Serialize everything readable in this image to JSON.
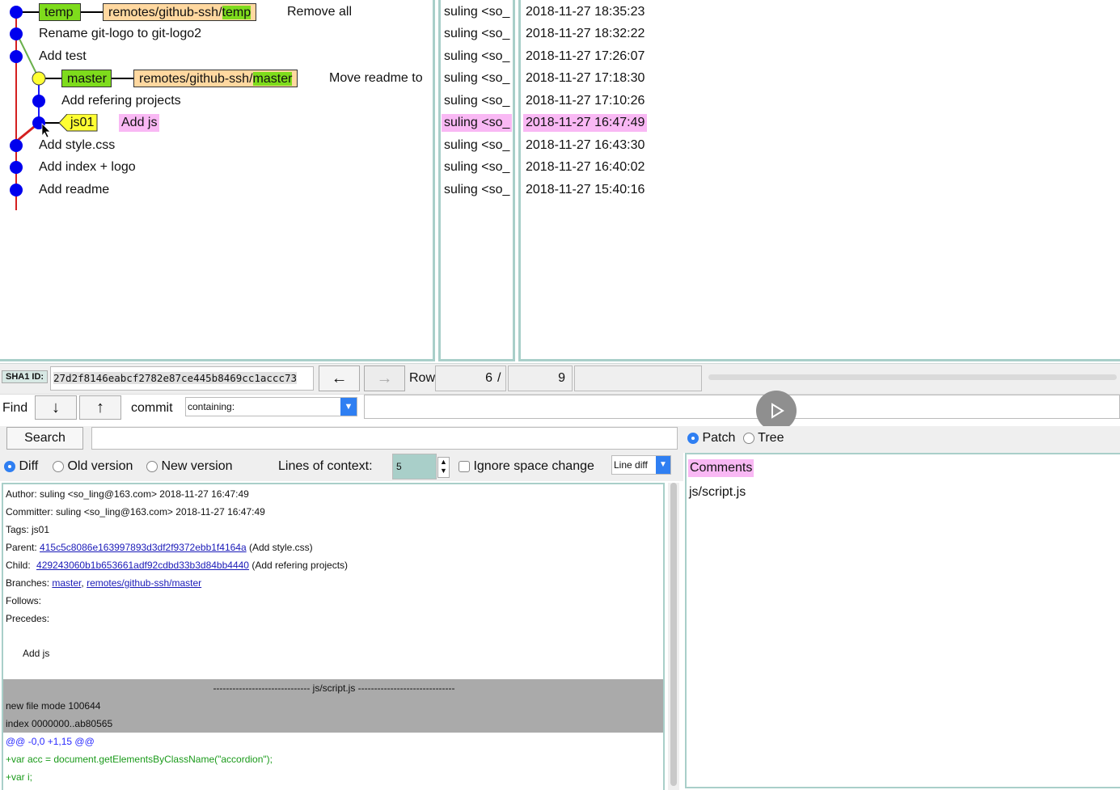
{
  "graph": {
    "rows": [
      {
        "message": "Remove all",
        "tags": [
          "temp"
        ],
        "remote": {
          "prefix": "remotes/github-ssh/",
          "branch": "temp"
        }
      },
      {
        "message": "Rename git-logo to git-logo2"
      },
      {
        "message": "Add test"
      },
      {
        "message": "Move readme to",
        "tags": [
          "master"
        ],
        "remote": {
          "prefix": "remotes/github-ssh/",
          "branch": "master"
        }
      },
      {
        "message": "Add refering projects"
      },
      {
        "message": "Add js",
        "tags": [
          "js01"
        ],
        "selected": true
      },
      {
        "message": "Add style.css"
      },
      {
        "message": "Add index + logo"
      },
      {
        "message": "Add readme"
      }
    ],
    "colors": {
      "node": "#0000ee",
      "node_head": "#ffff33",
      "line_main": "#d42020",
      "line_branch": "#6ab04c",
      "selection": "#f9b8f4"
    }
  },
  "authors": [
    "suling <so_",
    "suling <so_",
    "suling <so_",
    "suling <so_",
    "suling <so_",
    "suling <so_",
    "suling <so_",
    "suling <so_",
    "suling <so_"
  ],
  "dates": [
    "2018-11-27 18:35:23",
    "2018-11-27 18:32:22",
    "2018-11-27 17:26:07",
    "2018-11-27 17:18:30",
    "2018-11-27 17:10:26",
    "2018-11-27 16:47:49",
    "2018-11-27 16:43:30",
    "2018-11-27 16:40:02",
    "2018-11-27 15:40:16"
  ],
  "sha": {
    "label": "SHA1 ID:",
    "value": "27d2f8146eabcf2782e87ce445b8469cc1accc73"
  },
  "row": {
    "label": "Row",
    "current": "6",
    "separator": "/",
    "total": "9"
  },
  "find": {
    "label": "Find",
    "commit_label": "commit",
    "mode": "containing:",
    "value": ""
  },
  "search": {
    "button": "Search",
    "value": ""
  },
  "diff_options": {
    "diff": "Diff",
    "old_version": "Old version",
    "new_version": "New version",
    "context_label": "Lines of context:",
    "context_value": "5",
    "ignore_space": "Ignore space change",
    "line_diff": "Line diff"
  },
  "file_view": {
    "patch": "Patch",
    "tree": "Tree",
    "comments": "Comments",
    "files": [
      "js/script.js"
    ]
  },
  "details": {
    "author": "Author: suling <so_ling@163.com>  2018-11-27 16:47:49",
    "committer": "Committer: suling <so_ling@163.com>  2018-11-27 16:47:49",
    "tags": "Tags: js01",
    "parent_label": "Parent:",
    "parent_sha": "415c5c8086e163997893d3df2f9372ebb1f4164a",
    "parent_msg": "(Add style.css)",
    "child_label": "Child:",
    "child_sha": "429243060b1b653661adf92cdbd33b3d84bb4440",
    "child_msg": "(Add refering projects)",
    "branches_label": "Branches:",
    "branch_1": "master",
    "branch_sep": ",",
    "branch_2": "remotes/github-ssh/master",
    "follows": "Follows:",
    "precedes": "Precedes:",
    "message": "Add js",
    "file_header": "------------------------------ js/script.js ------------------------------",
    "mode": "new file mode 100644",
    "index": "index 0000000..ab80565",
    "hunk": "@@ -0,0 +1,15 @@",
    "added_1": "+var acc = document.getElementsByClassName(\"accordion\");",
    "added_2": "+var i;"
  }
}
